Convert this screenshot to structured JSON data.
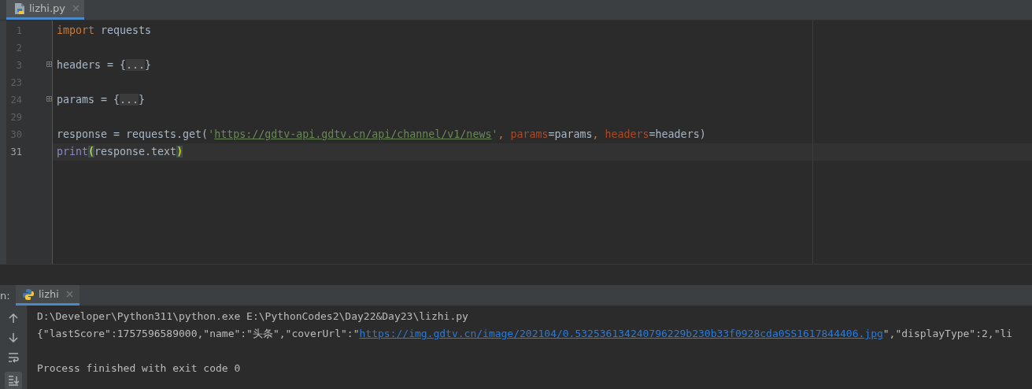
{
  "editor_tabs": [
    {
      "label": "lizhi.py",
      "selected": true
    }
  ],
  "code_lines": [
    {
      "number": "1",
      "current": false,
      "folded": false,
      "tokens": [
        {
          "kind": "keyword",
          "text": "import"
        },
        {
          "kind": "plain",
          "text": " requests"
        }
      ]
    },
    {
      "number": "2",
      "current": false,
      "folded": false
    },
    {
      "number": "3",
      "current": false,
      "folded": true,
      "tokens": [
        {
          "kind": "plain",
          "text": "headers = {"
        },
        {
          "kind": "fold",
          "text": "..."
        },
        {
          "kind": "plain",
          "text": "}"
        }
      ]
    },
    {
      "number": "23",
      "current": false,
      "folded": false
    },
    {
      "number": "24",
      "current": false,
      "folded": true,
      "tokens": [
        {
          "kind": "plain",
          "text": "params = {"
        },
        {
          "kind": "fold",
          "text": "..."
        },
        {
          "kind": "plain",
          "text": "}"
        }
      ]
    },
    {
      "number": "29",
      "current": false,
      "folded": false
    },
    {
      "number": "30",
      "current": false,
      "folded": false,
      "tokens": [
        {
          "kind": "plain",
          "text": "response = requests.get("
        },
        {
          "kind": "string",
          "text": "'"
        },
        {
          "kind": "url",
          "text": "https://gdtv-api.gdtv.cn/api/channel/v1/news"
        },
        {
          "kind": "string",
          "text": "'"
        },
        {
          "kind": "keyword",
          "text": ", "
        },
        {
          "kind": "param",
          "text": "params"
        },
        {
          "kind": "plain",
          "text": "=params"
        },
        {
          "kind": "keyword",
          "text": ", "
        },
        {
          "kind": "param",
          "text": "headers"
        },
        {
          "kind": "plain",
          "text": "=headers)"
        }
      ]
    },
    {
      "number": "31",
      "current": true,
      "folded": false,
      "tokens": [
        {
          "kind": "builtin",
          "text": "print"
        },
        {
          "kind": "match",
          "text": "("
        },
        {
          "kind": "plain",
          "text": "response.text"
        },
        {
          "kind": "match",
          "text": ")"
        }
      ]
    }
  ],
  "run_panel": {
    "label": "n:",
    "tabs": [
      {
        "label": "lizhi",
        "selected": true
      }
    ],
    "console": [
      {
        "kind": "plain",
        "parts": [
          {
            "kind": "text",
            "text": "D:\\Developer\\Python311\\python.exe E:\\PythonCodes2\\Day22&Day23\\lizhi.py"
          }
        ]
      },
      {
        "kind": "plain",
        "parts": [
          {
            "kind": "text",
            "text": "{\"lastScore\":1757596589000,\"name\":\"头条\",\"coverUrl\":\""
          },
          {
            "kind": "link",
            "text": "https://img.gdtv.cn/image/202104/0.532536134240796229b230b33f0928cda0SS1617844406.jpg"
          },
          {
            "kind": "text",
            "text": "\",\"displayType\":2,\"li"
          }
        ]
      },
      {
        "kind": "blank"
      },
      {
        "kind": "plain",
        "parts": [
          {
            "kind": "text",
            "text": "Process finished with exit code 0"
          }
        ]
      }
    ]
  }
}
